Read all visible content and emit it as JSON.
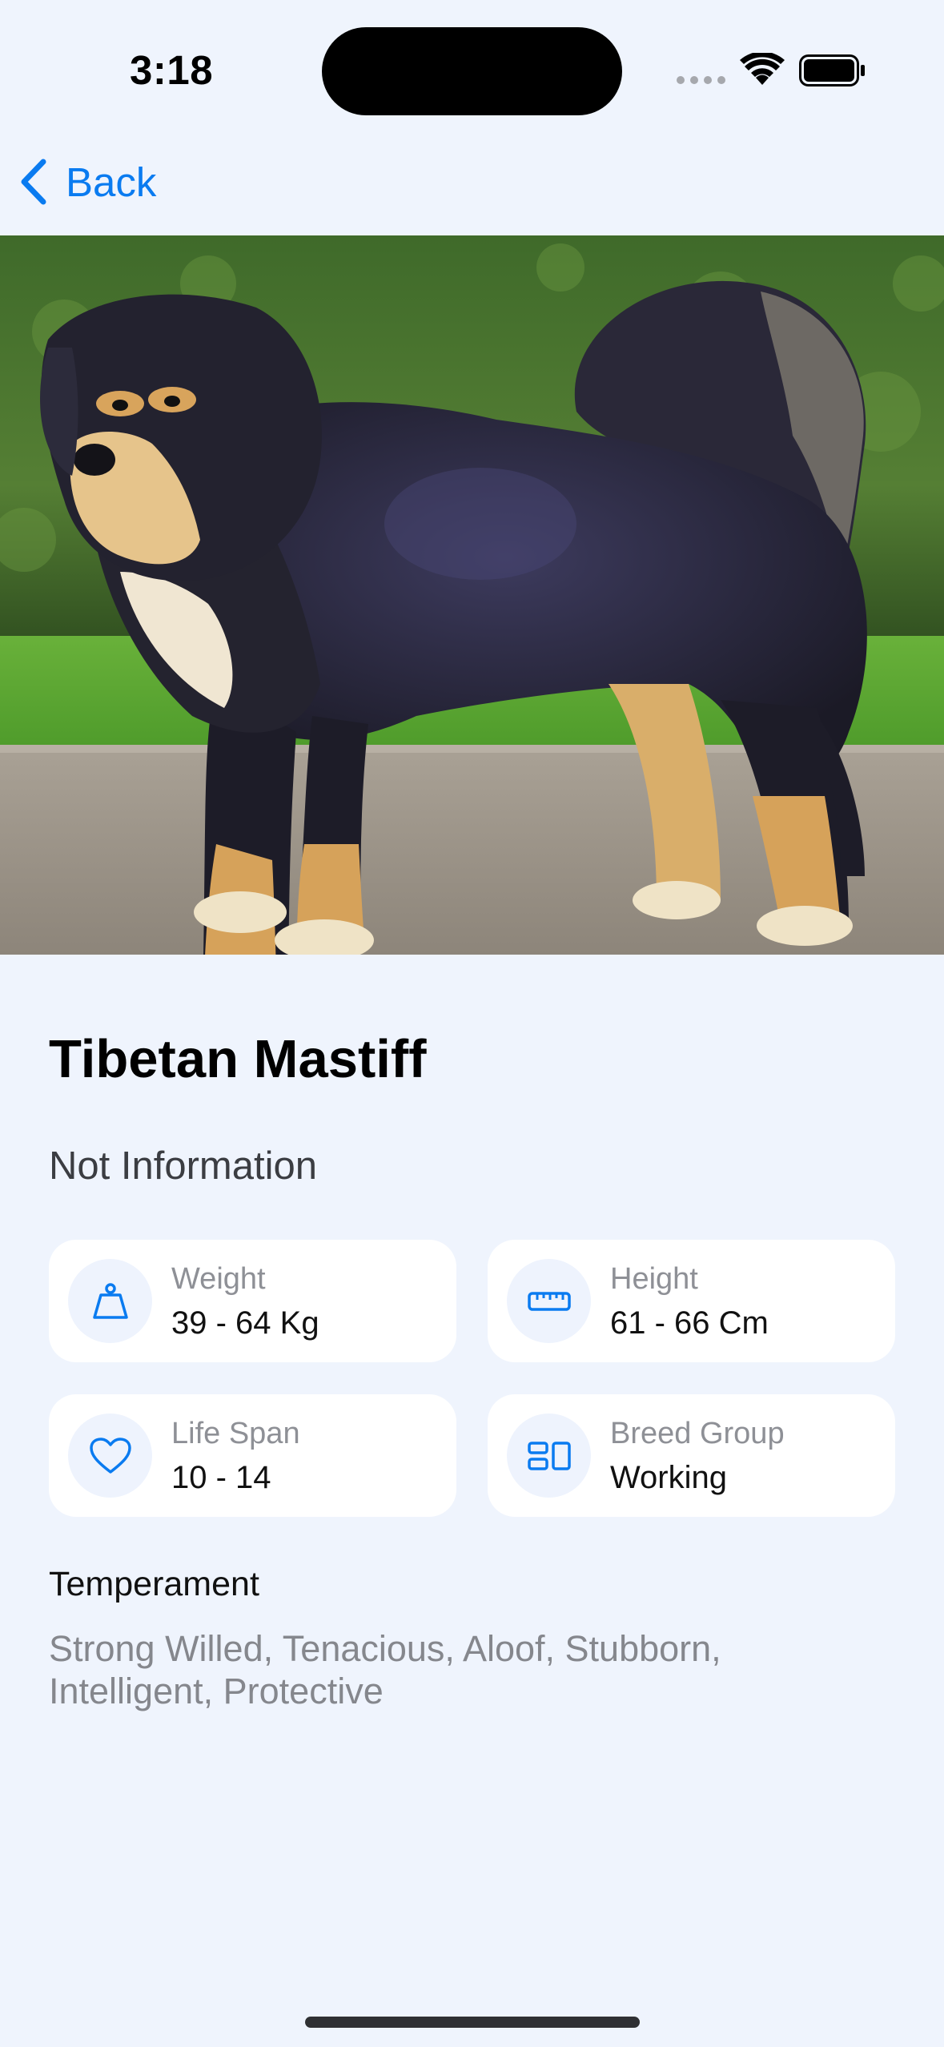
{
  "status_bar": {
    "time": "3:18"
  },
  "nav": {
    "back_label": "Back",
    "accent_color": "#0a7bf0"
  },
  "breed": {
    "name": "Tibetan Mastiff",
    "description": "Not Information",
    "stats": [
      {
        "label": "Weight",
        "value": "39 - 64 Kg",
        "icon": "weight-icon"
      },
      {
        "label": "Height",
        "value": "61 - 66 Cm",
        "icon": "ruler-icon"
      },
      {
        "label": "Life Span",
        "value": "10 - 14",
        "icon": "heart-icon"
      },
      {
        "label": "Breed Group",
        "value": "Working",
        "icon": "group-icon"
      }
    ],
    "temperament_heading": "Temperament",
    "temperament": "Strong Willed, Tenacious, Aloof, Stubborn, Intelligent, Protective"
  },
  "colors": {
    "background": "#eff4fd",
    "card": "#ffffff",
    "label_gray": "#8e9096"
  }
}
